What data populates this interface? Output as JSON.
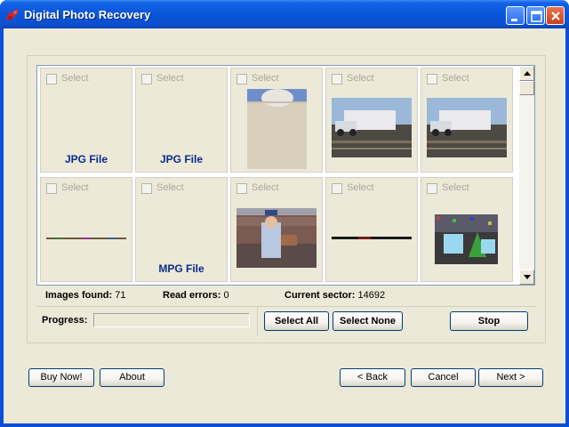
{
  "window": {
    "title": "Digital Photo Recovery"
  },
  "grid": {
    "cells": [
      {
        "select_label": "Select",
        "file_type": "JPG File",
        "thumb": "none"
      },
      {
        "select_label": "Select",
        "file_type": "JPG File",
        "thumb": "none"
      },
      {
        "select_label": "Select",
        "file_type": "",
        "thumb": "portrait-partial"
      },
      {
        "select_label": "Select",
        "file_type": "",
        "thumb": "car-trailer"
      },
      {
        "select_label": "Select",
        "file_type": "",
        "thumb": "car-trailer"
      },
      {
        "select_label": "Select",
        "file_type": "",
        "thumb": "thin-line-colored"
      },
      {
        "select_label": "Select",
        "file_type": "MPG File",
        "thumb": "none"
      },
      {
        "select_label": "Select",
        "file_type": "",
        "thumb": "stadium-crowd"
      },
      {
        "select_label": "Select",
        "file_type": "",
        "thumb": "thin-line-dark"
      },
      {
        "select_label": "Select",
        "file_type": "",
        "thumb": "3d-shapes-noise"
      }
    ]
  },
  "stats": {
    "images_found_label": "Images found:",
    "images_found_value": "71",
    "read_errors_label": "Read errors:",
    "read_errors_value": "0",
    "current_sector_label": "Current sector:",
    "current_sector_value": "14692"
  },
  "progress": {
    "label": "Progress:",
    "value_percent": 0
  },
  "buttons": {
    "select_all": "Select All",
    "select_none": "Select None",
    "stop": "Stop",
    "buy_now": "Buy Now!",
    "about": "About",
    "back": "< Back",
    "cancel": "Cancel",
    "next": "Next >"
  },
  "colors": {
    "titlebar": "#0a55d9",
    "file_type_text": "#0a2a8c",
    "window_bg": "#ece9d8"
  }
}
